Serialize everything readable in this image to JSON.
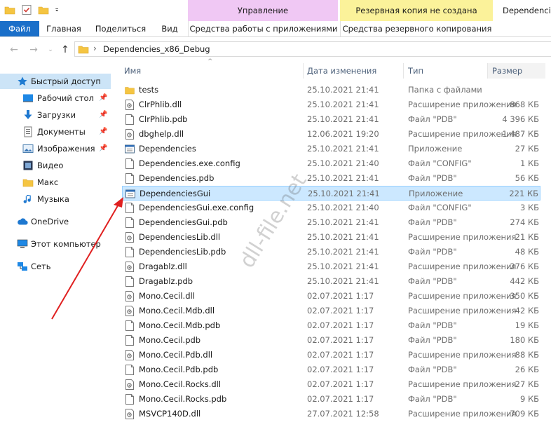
{
  "window": {
    "title": "Dependencies",
    "context_tabs": [
      {
        "label": "Управление",
        "color": "#f0c8f4"
      },
      {
        "label": "Резервная копия не создана",
        "color": "#fbf29a"
      }
    ]
  },
  "ribbon": {
    "tabs": [
      "Файл",
      "Главная",
      "Поделиться",
      "Вид",
      "Средства работы с приложениями",
      "Средства резервного копирования"
    ]
  },
  "address": {
    "path": "Dependencies_x86_Debug",
    "separator": "›"
  },
  "nav": {
    "items": [
      {
        "label": "Быстрый доступ",
        "icon": "star-icon",
        "pinned": false
      },
      {
        "label": "Рабочий стол",
        "icon": "desktop-icon",
        "pinned": true
      },
      {
        "label": "Загрузки",
        "icon": "download-icon",
        "pinned": true
      },
      {
        "label": "Документы",
        "icon": "documents-icon",
        "pinned": true
      },
      {
        "label": "Изображения",
        "icon": "pictures-icon",
        "pinned": true
      },
      {
        "label": "Видео",
        "icon": "video-icon",
        "pinned": false
      },
      {
        "label": "Макс",
        "icon": "folder-icon",
        "pinned": false
      },
      {
        "label": "Музыка",
        "icon": "music-icon",
        "pinned": false
      },
      {
        "label": "OneDrive",
        "icon": "cloud-icon",
        "pinned": false
      },
      {
        "label": "Этот компьютер",
        "icon": "computer-icon",
        "pinned": false
      },
      {
        "label": "Сеть",
        "icon": "network-icon",
        "pinned": false
      }
    ]
  },
  "columns": {
    "name": "Имя",
    "date": "Дата изменения",
    "type": "Тип",
    "size": "Размер"
  },
  "files": [
    {
      "name": "tests",
      "date": "25.10.2021 21:41",
      "type": "Папка с файлами",
      "size": "",
      "icon": "folder-icon"
    },
    {
      "name": "ClrPhlib.dll",
      "date": "25.10.2021 21:41",
      "type": "Расширение приложения",
      "size": "868 КБ",
      "icon": "dll-icon"
    },
    {
      "name": "ClrPhlib.pdb",
      "date": "25.10.2021 21:41",
      "type": "Файл \"PDB\"",
      "size": "4 396 КБ",
      "icon": "file-icon"
    },
    {
      "name": "dbghelp.dll",
      "date": "12.06.2021 19:20",
      "type": "Расширение приложения",
      "size": "1 487 КБ",
      "icon": "dll-icon"
    },
    {
      "name": "Dependencies",
      "date": "25.10.2021 21:41",
      "type": "Приложение",
      "size": "27 КБ",
      "icon": "app-icon"
    },
    {
      "name": "Dependencies.exe.config",
      "date": "25.10.2021 21:40",
      "type": "Файл \"CONFIG\"",
      "size": "1 КБ",
      "icon": "file-icon"
    },
    {
      "name": "Dependencies.pdb",
      "date": "25.10.2021 21:41",
      "type": "Файл \"PDB\"",
      "size": "56 КБ",
      "icon": "file-icon"
    },
    {
      "name": "DependenciesGui",
      "date": "25.10.2021 21:41",
      "type": "Приложение",
      "size": "221 КБ",
      "icon": "app-icon",
      "selected": true
    },
    {
      "name": "DependenciesGui.exe.config",
      "date": "25.10.2021 21:40",
      "type": "Файл \"CONFIG\"",
      "size": "3 КБ",
      "icon": "file-icon"
    },
    {
      "name": "DependenciesGui.pdb",
      "date": "25.10.2021 21:41",
      "type": "Файл \"PDB\"",
      "size": "274 КБ",
      "icon": "file-icon"
    },
    {
      "name": "DependenciesLib.dll",
      "date": "25.10.2021 21:41",
      "type": "Расширение приложения",
      "size": "21 КБ",
      "icon": "dll-icon"
    },
    {
      "name": "DependenciesLib.pdb",
      "date": "25.10.2021 21:41",
      "type": "Файл \"PDB\"",
      "size": "48 КБ",
      "icon": "file-icon"
    },
    {
      "name": "Dragablz.dll",
      "date": "25.10.2021 21:41",
      "type": "Расширение приложения",
      "size": "276 КБ",
      "icon": "dll-icon"
    },
    {
      "name": "Dragablz.pdb",
      "date": "25.10.2021 21:41",
      "type": "Файл \"PDB\"",
      "size": "442 КБ",
      "icon": "file-icon"
    },
    {
      "name": "Mono.Cecil.dll",
      "date": "02.07.2021 1:17",
      "type": "Расширение приложения",
      "size": "350 КБ",
      "icon": "dll-icon"
    },
    {
      "name": "Mono.Cecil.Mdb.dll",
      "date": "02.07.2021 1:17",
      "type": "Расширение приложения",
      "size": "42 КБ",
      "icon": "dll-icon"
    },
    {
      "name": "Mono.Cecil.Mdb.pdb",
      "date": "02.07.2021 1:17",
      "type": "Файл \"PDB\"",
      "size": "19 КБ",
      "icon": "file-icon"
    },
    {
      "name": "Mono.Cecil.pdb",
      "date": "02.07.2021 1:17",
      "type": "Файл \"PDB\"",
      "size": "180 КБ",
      "icon": "file-icon"
    },
    {
      "name": "Mono.Cecil.Pdb.dll",
      "date": "02.07.2021 1:17",
      "type": "Расширение приложения",
      "size": "88 КБ",
      "icon": "dll-icon"
    },
    {
      "name": "Mono.Cecil.Pdb.pdb",
      "date": "02.07.2021 1:17",
      "type": "Файл \"PDB\"",
      "size": "26 КБ",
      "icon": "file-icon"
    },
    {
      "name": "Mono.Cecil.Rocks.dll",
      "date": "02.07.2021 1:17",
      "type": "Расширение приложения",
      "size": "27 КБ",
      "icon": "dll-icon"
    },
    {
      "name": "Mono.Cecil.Rocks.pdb",
      "date": "02.07.2021 1:17",
      "type": "Файл \"PDB\"",
      "size": "9 КБ",
      "icon": "file-icon"
    },
    {
      "name": "MSVCP140D.dll",
      "date": "27.07.2021 12:58",
      "type": "Расширение приложения",
      "size": "709 КБ",
      "icon": "dll-icon"
    }
  ],
  "watermark": "dll-file.net",
  "colors": {
    "file_tab": "#1a6fc9",
    "selection": "#cce8ff",
    "annotation_arrow": "#e02020"
  }
}
